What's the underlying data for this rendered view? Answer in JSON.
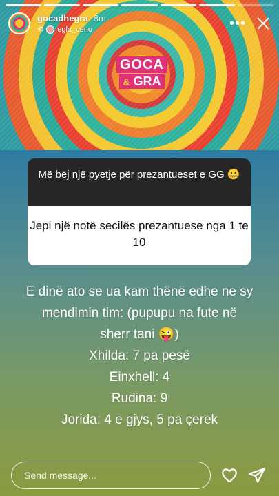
{
  "story": {
    "progress_total": 7,
    "progress_done": 6,
    "username": "gocadhegra",
    "time": "8m",
    "reposted_from": "egla_ceno"
  },
  "hero": {
    "logo_line1": "GOCA",
    "logo_amp": "&",
    "logo_line2": "GRA"
  },
  "question": {
    "prompt": "Më bëj një pyetje për prezantueset e GG 🤐",
    "answer": "Jepi një notë secilës prezantuese nga 1 te 10"
  },
  "body": {
    "lines": [
      "E dinë ato se ua kam thënë edhe ne sy",
      "mendimin tim: (pupupu na fute në",
      "sherr tani 😜)",
      "Xhilda: 7 pa pesë",
      "Einxhell: 4",
      "Rudina: 9",
      "Jorida: 4 e gjys, 5 pa çerek"
    ]
  },
  "footer": {
    "message_placeholder": "Send message..."
  },
  "icons": {
    "more": "more-options-icon",
    "close": "close-icon",
    "repost": "repost-icon",
    "heart": "heart-icon",
    "send": "send-icon"
  }
}
